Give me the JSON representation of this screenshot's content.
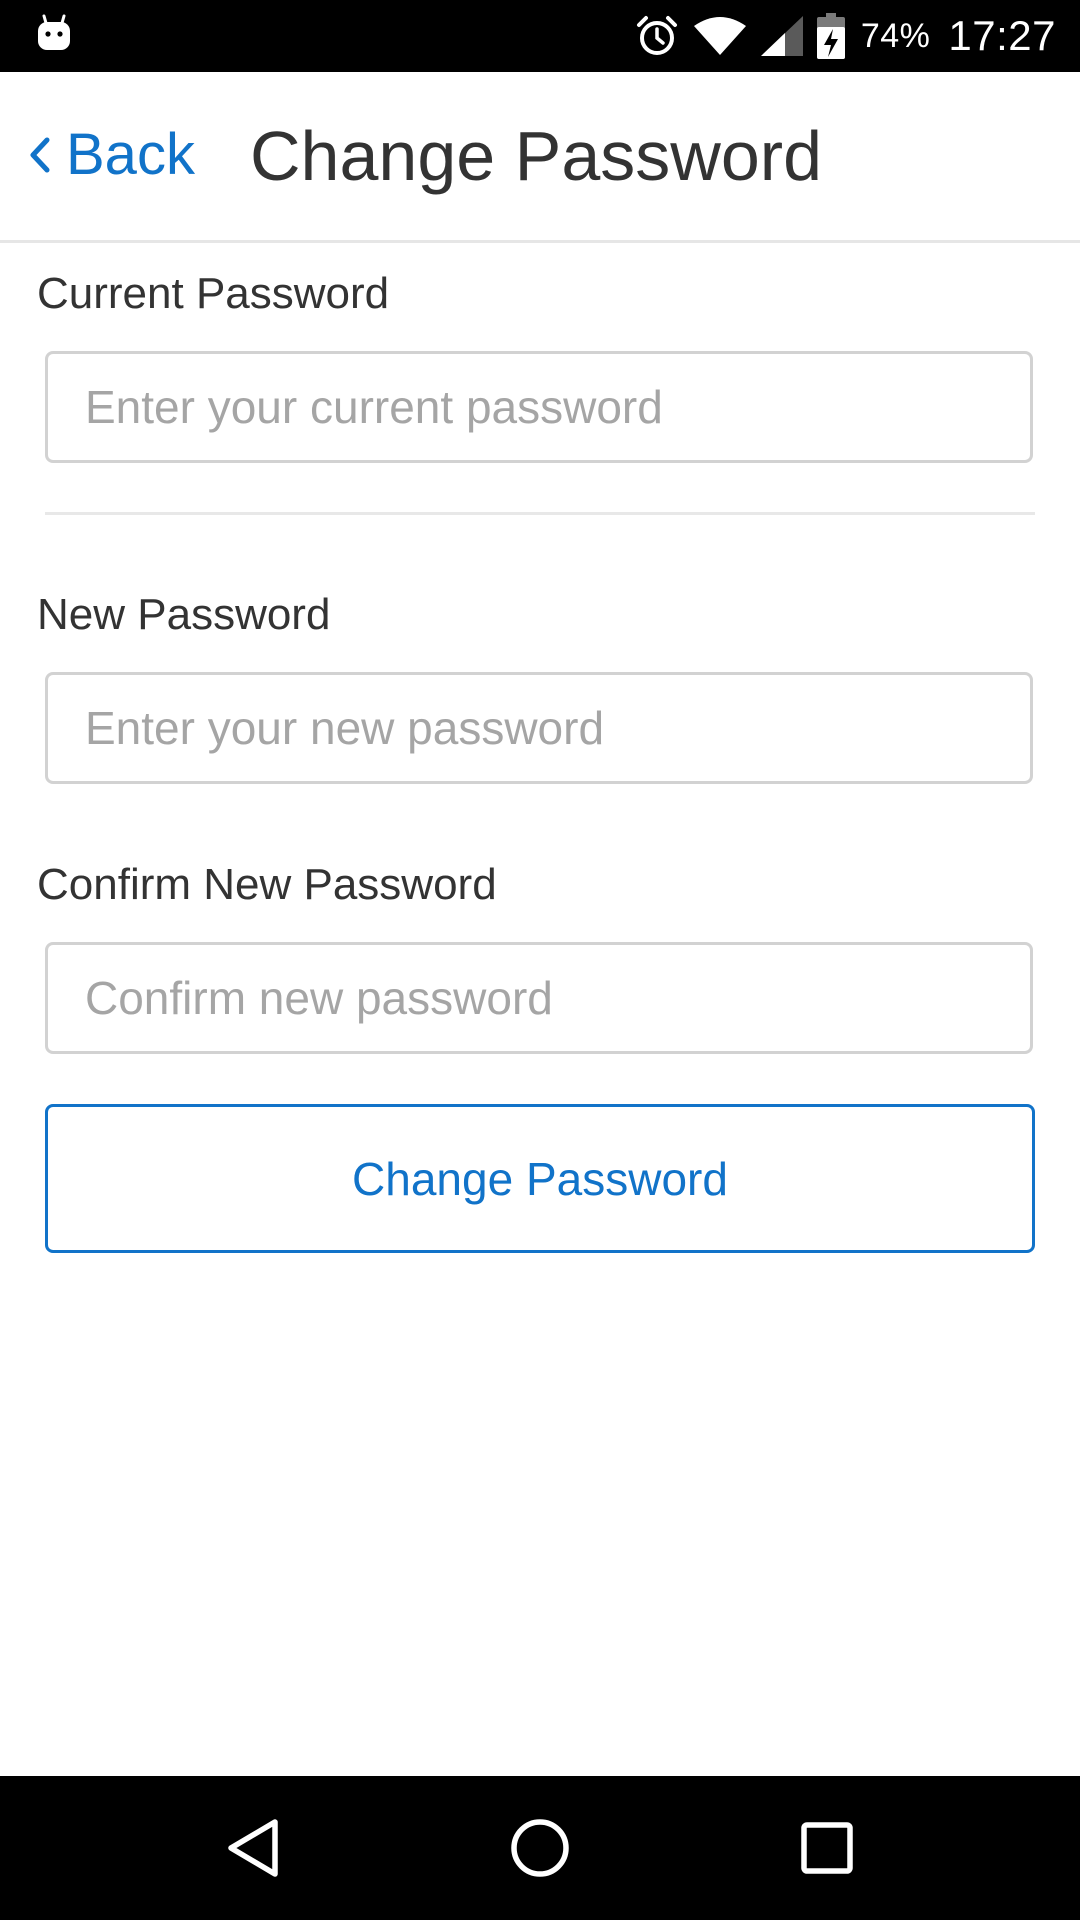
{
  "status_bar": {
    "battery_percent": "74%",
    "time": "17:27",
    "icons": [
      "android-icon",
      "alarm-icon",
      "wifi-icon",
      "cell-signal-icon",
      "battery-charging-icon"
    ]
  },
  "header": {
    "back_label": "Back",
    "title": "Change Password"
  },
  "form": {
    "current": {
      "label": "Current Password",
      "placeholder": "Enter your current password",
      "value": ""
    },
    "new": {
      "label": "New Password",
      "placeholder": "Enter your new password",
      "value": ""
    },
    "confirm": {
      "label": "Confirm New Password",
      "placeholder": "Confirm new password",
      "value": ""
    },
    "submit_label": "Change Password"
  },
  "nav_bar": {
    "icons": [
      "nav-back-icon",
      "nav-home-icon",
      "nav-recents-icon"
    ]
  },
  "colors": {
    "accent": "#1173c9",
    "text": "#333333",
    "placeholder": "#a5a5a5",
    "border": "#d2d2d2",
    "system_bar": "#000000"
  }
}
